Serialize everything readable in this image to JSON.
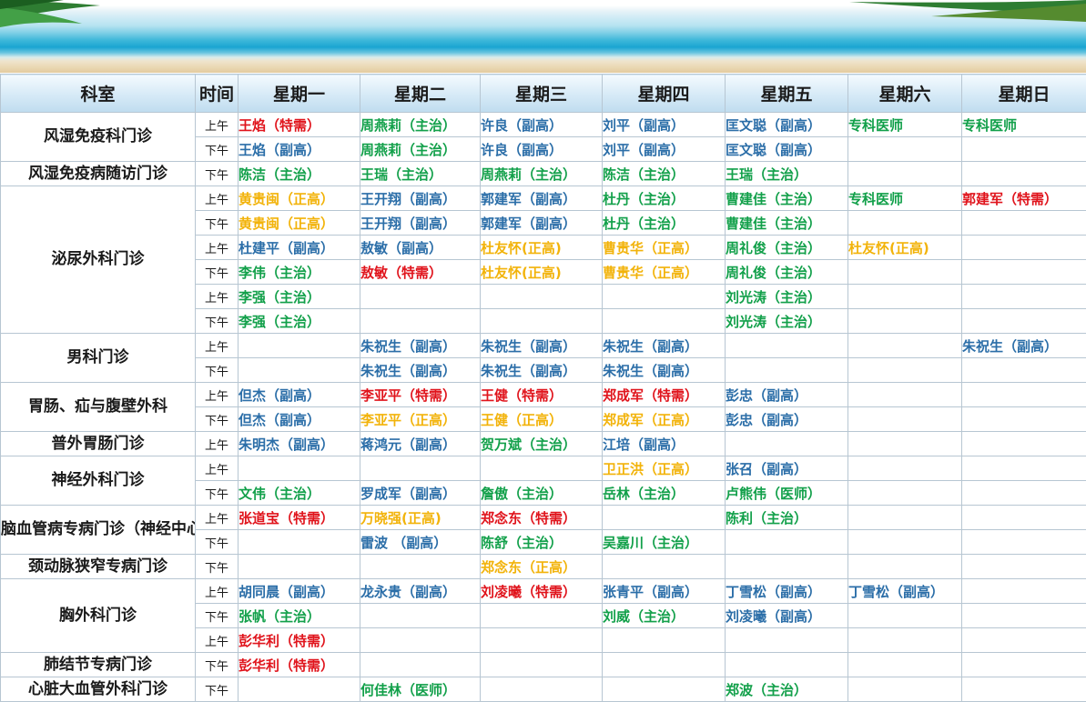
{
  "colors": {
    "blue": "#2b6ea8",
    "green": "#12a04a",
    "red": "#e0141c",
    "orange": "#f2b30a"
  },
  "headers": {
    "dept": "科室",
    "time": "时间",
    "days": [
      "星期一",
      "星期二",
      "星期三",
      "星期四",
      "星期五",
      "星期六",
      "星期日"
    ]
  },
  "rows": [
    {
      "dept": "风湿免疫科门诊",
      "rowspan": 2,
      "slot": "上午",
      "cells": [
        {
          "t": "王焰（特需）",
          "c": "red"
        },
        {
          "t": "周燕莉（主治）",
          "c": "green"
        },
        {
          "t": "许良（副高）",
          "c": "blue"
        },
        {
          "t": "刘平（副高）",
          "c": "blue"
        },
        {
          "t": "匡文聪（副高）",
          "c": "blue"
        },
        {
          "t": "专科医师",
          "c": "green"
        },
        {
          "t": "专科医师",
          "c": "green"
        }
      ]
    },
    {
      "slot": "下午",
      "cells": [
        {
          "t": "王焰（副高）",
          "c": "blue"
        },
        {
          "t": "周燕莉（主治）",
          "c": "green"
        },
        {
          "t": "许良（副高）",
          "c": "blue"
        },
        {
          "t": "刘平（副高）",
          "c": "blue"
        },
        {
          "t": "匡文聪（副高）",
          "c": "blue"
        },
        {
          "t": ""
        },
        {
          "t": ""
        }
      ]
    },
    {
      "dept": "风湿免疫病随访门诊",
      "rowspan": 1,
      "slot": "下午",
      "cells": [
        {
          "t": "陈洁（主治）",
          "c": "green"
        },
        {
          "t": "王瑞（主治）",
          "c": "green"
        },
        {
          "t": "周燕莉（主治）",
          "c": "green"
        },
        {
          "t": "陈洁（主治）",
          "c": "green"
        },
        {
          "t": "王瑞（主治）",
          "c": "green"
        },
        {
          "t": ""
        },
        {
          "t": ""
        }
      ]
    },
    {
      "dept": "泌尿外科门诊",
      "rowspan": 6,
      "slot": "上午",
      "cells": [
        {
          "t": "黄贵闽（正高）",
          "c": "orange"
        },
        {
          "t": "王开翔（副高）",
          "c": "blue"
        },
        {
          "t": "郭建军（副高）",
          "c": "blue"
        },
        {
          "t": "杜丹（主治）",
          "c": "green"
        },
        {
          "t": "曹建佳（主治）",
          "c": "green"
        },
        {
          "t": "专科医师",
          "c": "green"
        },
        {
          "t": "郭建军（特需）",
          "c": "red"
        }
      ]
    },
    {
      "slot": "下午",
      "cells": [
        {
          "t": "黄贵闽（正高）",
          "c": "orange"
        },
        {
          "t": "王开翔（副高）",
          "c": "blue"
        },
        {
          "t": "郭建军（副高）",
          "c": "blue"
        },
        {
          "t": "杜丹（主治）",
          "c": "green"
        },
        {
          "t": "曹建佳（主治）",
          "c": "green"
        },
        {
          "t": ""
        },
        {
          "t": ""
        }
      ]
    },
    {
      "slot": "上午",
      "cells": [
        {
          "t": "杜建平（副高）",
          "c": "blue"
        },
        {
          "t": "敖敏（副高）",
          "c": "blue"
        },
        {
          "t": "杜友怀(正高)",
          "c": "orange"
        },
        {
          "t": "曹贵华（正高）",
          "c": "orange"
        },
        {
          "t": "周礼俊（主治）",
          "c": "green"
        },
        {
          "t": "杜友怀(正高)",
          "c": "orange"
        },
        {
          "t": ""
        }
      ]
    },
    {
      "slot": "下午",
      "cells": [
        {
          "t": "李伟（主治）",
          "c": "green"
        },
        {
          "t": "敖敏（特需）",
          "c": "red"
        },
        {
          "t": "杜友怀(正高)",
          "c": "orange"
        },
        {
          "t": "曹贵华（正高）",
          "c": "orange"
        },
        {
          "t": "周礼俊（主治）",
          "c": "green"
        },
        {
          "t": ""
        },
        {
          "t": ""
        }
      ]
    },
    {
      "slot": "上午",
      "cells": [
        {
          "t": "李强（主治）",
          "c": "green"
        },
        {
          "t": ""
        },
        {
          "t": ""
        },
        {
          "t": ""
        },
        {
          "t": "刘光涛（主治）",
          "c": "green"
        },
        {
          "t": ""
        },
        {
          "t": ""
        }
      ]
    },
    {
      "slot": "下午",
      "cells": [
        {
          "t": "李强（主治）",
          "c": "green"
        },
        {
          "t": ""
        },
        {
          "t": ""
        },
        {
          "t": ""
        },
        {
          "t": "刘光涛（主治）",
          "c": "green"
        },
        {
          "t": ""
        },
        {
          "t": ""
        }
      ]
    },
    {
      "dept": "男科门诊",
      "rowspan": 2,
      "slot": "上午",
      "cells": [
        {
          "t": ""
        },
        {
          "t": "朱祝生（副高）",
          "c": "blue"
        },
        {
          "t": "朱祝生（副高）",
          "c": "blue"
        },
        {
          "t": "朱祝生（副高）",
          "c": "blue"
        },
        {
          "t": ""
        },
        {
          "t": ""
        },
        {
          "t": "朱祝生（副高）",
          "c": "blue"
        }
      ]
    },
    {
      "slot": "下午",
      "cells": [
        {
          "t": ""
        },
        {
          "t": "朱祝生（副高）",
          "c": "blue"
        },
        {
          "t": "朱祝生（副高）",
          "c": "blue"
        },
        {
          "t": "朱祝生（副高）",
          "c": "blue"
        },
        {
          "t": ""
        },
        {
          "t": ""
        },
        {
          "t": ""
        }
      ]
    },
    {
      "dept": "胃肠、疝与腹壁外科",
      "rowspan": 2,
      "slot": "上午",
      "cells": [
        {
          "t": "但杰（副高）",
          "c": "blue"
        },
        {
          "t": "李亚平（特需）",
          "c": "red"
        },
        {
          "t": "王健（特需）",
          "c": "red"
        },
        {
          "t": "郑成军（特需）",
          "c": "red"
        },
        {
          "t": "彭忠（副高）",
          "c": "blue"
        },
        {
          "t": ""
        },
        {
          "t": ""
        }
      ]
    },
    {
      "slot": "下午",
      "cells": [
        {
          "t": "但杰（副高）",
          "c": "blue"
        },
        {
          "t": "李亚平（正高）",
          "c": "orange"
        },
        {
          "t": "王健（正高）",
          "c": "orange"
        },
        {
          "t": "郑成军（正高）",
          "c": "orange"
        },
        {
          "t": "彭忠（副高）",
          "c": "blue"
        },
        {
          "t": ""
        },
        {
          "t": ""
        }
      ]
    },
    {
      "dept": "普外胃肠门诊",
      "rowspan": 1,
      "slot": "上午",
      "cells": [
        {
          "t": "朱明杰（副高）",
          "c": "blue"
        },
        {
          "t": " 蒋鸿元（副高）",
          "c": "blue"
        },
        {
          "t": " 贺万斌（主治）",
          "c": "green"
        },
        {
          "t": "  江培（副高）",
          "c": "blue"
        },
        {
          "t": ""
        },
        {
          "t": ""
        },
        {
          "t": ""
        }
      ]
    },
    {
      "dept": "神经外科门诊",
      "rowspan": 2,
      "slot": "上午",
      "cells": [
        {
          "t": ""
        },
        {
          "t": ""
        },
        {
          "t": ""
        },
        {
          "t": "卫正洪（正高）",
          "c": "orange"
        },
        {
          "t": "张召（副高）",
          "c": "blue"
        },
        {
          "t": ""
        },
        {
          "t": ""
        }
      ]
    },
    {
      "slot": "下午",
      "cells": [
        {
          "t": "文伟（主治）",
          "c": "green"
        },
        {
          "t": "罗成军（副高）",
          "c": "blue"
        },
        {
          "t": "詹傲（主治）",
          "c": "green"
        },
        {
          "t": "岳林（主治）",
          "c": "green"
        },
        {
          "t": "卢熊伟（医师）",
          "c": "green"
        },
        {
          "t": ""
        },
        {
          "t": ""
        }
      ]
    },
    {
      "dept": "脑血管病专病门诊（神经中心）",
      "rowspan": 2,
      "slot": "上午",
      "cells": [
        {
          "t": "张道宝（特需）",
          "c": "red"
        },
        {
          "t": "万晓强(正高)",
          "c": "orange"
        },
        {
          "t": "郑念东（特需）",
          "c": "red"
        },
        {
          "t": ""
        },
        {
          "t": "陈利（主治）",
          "c": "green"
        },
        {
          "t": ""
        },
        {
          "t": ""
        }
      ]
    },
    {
      "slot": "下午",
      "cells": [
        {
          "t": ""
        },
        {
          "t": "雷波 （副高）",
          "c": "blue"
        },
        {
          "t": "陈舒（主治）",
          "c": "green"
        },
        {
          "t": "吴嘉川（主治）",
          "c": "green"
        },
        {
          "t": ""
        },
        {
          "t": ""
        },
        {
          "t": ""
        }
      ]
    },
    {
      "dept": "颈动脉狭窄专病门诊",
      "rowspan": 1,
      "slot": "下午",
      "cells": [
        {
          "t": ""
        },
        {
          "t": ""
        },
        {
          "t": "郑念东（正高）",
          "c": "orange"
        },
        {
          "t": ""
        },
        {
          "t": ""
        },
        {
          "t": ""
        },
        {
          "t": ""
        }
      ]
    },
    {
      "dept": "胸外科门诊",
      "rowspan": 3,
      "slot": "上午",
      "cells": [
        {
          "t": "胡同晨（副高）",
          "c": "blue"
        },
        {
          "t": "龙永贵（副高）",
          "c": "blue"
        },
        {
          "t": "刘凌曦（特需）",
          "c": "red"
        },
        {
          "t": "张青平（副高）",
          "c": "blue"
        },
        {
          "t": "丁雪松（副高）",
          "c": "blue"
        },
        {
          "t": "丁雪松（副高）",
          "c": "blue"
        },
        {
          "t": ""
        }
      ]
    },
    {
      "slot": "下午",
      "cells": [
        {
          "t": "张帆（主治）",
          "c": "green"
        },
        {
          "t": ""
        },
        {
          "t": ""
        },
        {
          "t": "刘威（主治）",
          "c": "green"
        },
        {
          "t": "刘凌曦（副高）",
          "c": "blue"
        },
        {
          "t": ""
        },
        {
          "t": ""
        }
      ]
    },
    {
      "slot": "上午",
      "cells": [
        {
          "t": "彭华利（特需）",
          "c": "red"
        },
        {
          "t": ""
        },
        {
          "t": ""
        },
        {
          "t": ""
        },
        {
          "t": ""
        },
        {
          "t": ""
        },
        {
          "t": ""
        }
      ]
    },
    {
      "dept": "肺结节专病门诊",
      "rowspan": 1,
      "slot": "下午",
      "cells": [
        {
          "t": "彭华利（特需）",
          "c": "red"
        },
        {
          "t": ""
        },
        {
          "t": ""
        },
        {
          "t": ""
        },
        {
          "t": ""
        },
        {
          "t": ""
        },
        {
          "t": ""
        }
      ]
    },
    {
      "dept": "心脏大血管外科门诊",
      "rowspan": 1,
      "slot": "下午",
      "cells": [
        {
          "t": ""
        },
        {
          "t": "何佳林（医师）",
          "c": "green"
        },
        {
          "t": ""
        },
        {
          "t": ""
        },
        {
          "t": "郑波（主治）",
          "c": "green"
        },
        {
          "t": ""
        },
        {
          "t": ""
        }
      ]
    }
  ]
}
